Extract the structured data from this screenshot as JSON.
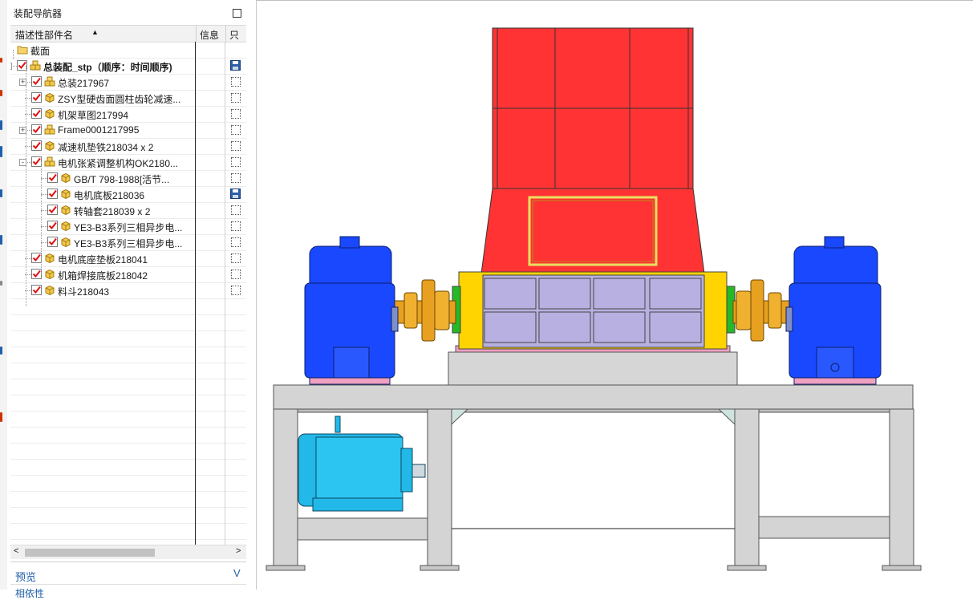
{
  "panel": {
    "title": "装配导航器",
    "columns": {
      "name": "描述性部件名",
      "info": "信息",
      "readonly": "只"
    },
    "sort_glyph": "▲"
  },
  "tree": [
    {
      "label": "截面",
      "icon": "folder-icon",
      "check": false,
      "bold": false,
      "ro": "none"
    },
    {
      "label": "总装配_stp（顺序：时间顺序)",
      "icon": "assembly-icon",
      "check": true,
      "bold": true,
      "ro": "save"
    },
    {
      "label": "总装217967",
      "icon": "assembly-icon",
      "check": true,
      "bold": false,
      "ro": "box"
    },
    {
      "label": "ZSY型硬齿面圆柱齿轮减速...",
      "icon": "part-icon",
      "check": true,
      "bold": false,
      "ro": "box"
    },
    {
      "label": "机架草图217994",
      "icon": "part-icon",
      "check": true,
      "bold": false,
      "ro": "box"
    },
    {
      "label": "Frame0001217995",
      "icon": "assembly-icon",
      "check": true,
      "bold": false,
      "ro": "box"
    },
    {
      "label": "减速机垫铁218034 x 2",
      "icon": "part-icon",
      "check": true,
      "bold": false,
      "ro": "box"
    },
    {
      "label": "电机张紧调整机构OK2180...",
      "icon": "assembly-icon",
      "check": true,
      "bold": false,
      "ro": "box"
    },
    {
      "label": "GB/T 798-1988[活节...",
      "icon": "part-icon",
      "check": true,
      "bold": false,
      "ro": "box"
    },
    {
      "label": "电机底板218036",
      "icon": "part-icon",
      "check": true,
      "bold": false,
      "ro": "save"
    },
    {
      "label": "转轴套218039 x 2",
      "icon": "part-icon",
      "check": true,
      "bold": false,
      "ro": "box"
    },
    {
      "label": "YE3-B3系列三相异步电...",
      "icon": "part-icon",
      "check": true,
      "bold": false,
      "ro": "box"
    },
    {
      "label": "YE3-B3系列三相异步电...",
      "icon": "part-icon",
      "check": true,
      "bold": false,
      "ro": "box"
    },
    {
      "label": "电机底座垫板218041",
      "icon": "part-icon",
      "check": true,
      "bold": false,
      "ro": "box"
    },
    {
      "label": "机箱焊接底板218042",
      "icon": "part-icon",
      "check": true,
      "bold": false,
      "ro": "box"
    },
    {
      "label": "料斗218043",
      "icon": "part-icon",
      "check": true,
      "bold": false,
      "ro": "box"
    }
  ],
  "scroll": {
    "left": "<",
    "right": ">"
  },
  "preview": {
    "label": "预览",
    "chevron": "V"
  },
  "next_section": {
    "label": "相依性"
  },
  "colors": {
    "hopper": "#ff3333",
    "gearbox": "#1a48ff",
    "coupling": "#e8a020",
    "box_panel": "#b8b0e0",
    "motor": "#22b8e8",
    "frame": "#d4d4d4"
  }
}
